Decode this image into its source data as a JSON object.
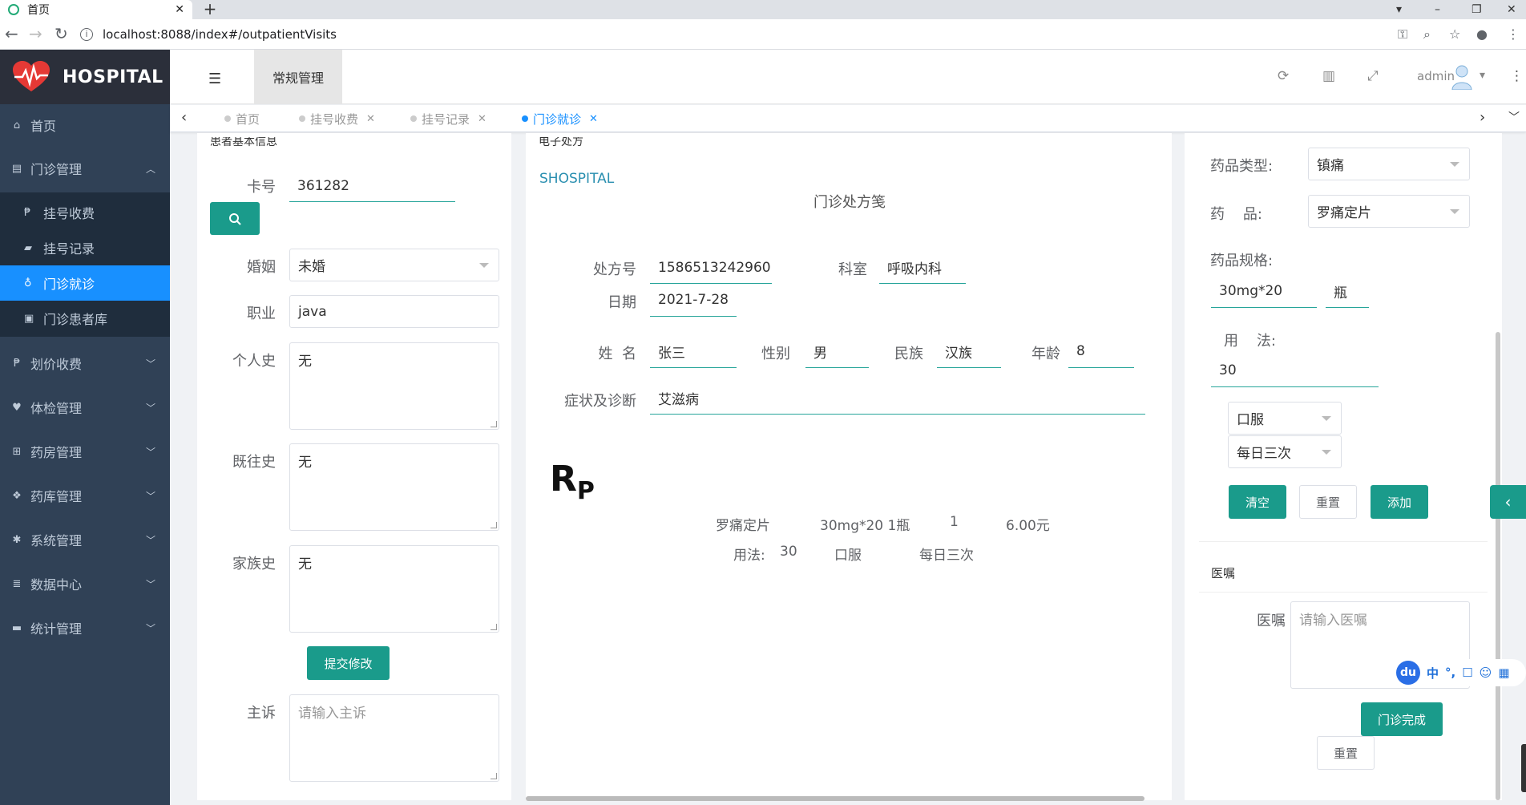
{
  "browser": {
    "tab_title": "首页",
    "new_tab": "+",
    "url": "localhost:8088/index#/outpatientVisits"
  },
  "app": {
    "name": "HOSPITAL"
  },
  "sidebar": {
    "home": "首页",
    "outpatient": "门诊管理",
    "sub": [
      "挂号收费",
      "挂号记录",
      "门诊就诊",
      "门诊患者库"
    ],
    "pricing": "划价收费",
    "exam": "体检管理",
    "pharmacy": "药房管理",
    "warehouse": "药库管理",
    "system": "系统管理",
    "data": "数据中心",
    "stats": "统计管理"
  },
  "header": {
    "section": "常规管理",
    "user": "admin"
  },
  "tags": [
    "首页",
    "挂号收费",
    "挂号记录",
    "门诊就诊"
  ],
  "patient": {
    "heading": "患者基本信息",
    "card_label": "卡号",
    "card_value": "361282",
    "marriage_label": "婚姻",
    "marriage_value": "未婚",
    "job_label": "职业",
    "job_value": "java",
    "personal_label": "个人史",
    "personal_value": "无",
    "past_label": "既往史",
    "past_value": "无",
    "family_label": "家族史",
    "family_value": "无",
    "submit": "提交修改",
    "complaint_label": "主诉",
    "complaint_placeholder": "请输入主诉"
  },
  "prescription": {
    "heading": "电子处方",
    "brand": "SHOSPITAL",
    "title": "门诊处方笺",
    "no_label": "处方号",
    "no_value": "1586513242960",
    "dept_label": "科室",
    "dept_value": "呼吸内科",
    "date_label": "日期",
    "date_value": "2021-7-28",
    "name_label": "姓  名",
    "name_value": "张三",
    "gender_label": "性别",
    "gender_value": "男",
    "ethnic_label": "民族",
    "ethnic_value": "汉族",
    "age_label": "年龄",
    "age_value": "8",
    "diag_label": "症状及诊断",
    "diag_value": "艾滋病",
    "rp_r": "R",
    "rp_p": "P",
    "drug_name": "罗痛定片",
    "drug_spec": "30mg*20 1瓶",
    "drug_qty": "1",
    "drug_price": "6.00元",
    "usage_label": "用法:",
    "usage_value": "30",
    "usage_route": "口服",
    "usage_freq": "每日三次"
  },
  "drugform": {
    "type_label": "药品类型:",
    "type_value": "镇痛",
    "drug_label": "药    品:",
    "drug_value": "罗痛定片",
    "spec_label": "药品规格:",
    "spec_value": "30mg*20",
    "unit_value": "瓶",
    "usage_label": "用    法:",
    "usage_value": "30",
    "route_value": "口服",
    "freq_value": "每日三次",
    "clear": "清空",
    "reset": "重置",
    "add": "添加",
    "advice_heading": "医嘱",
    "advice_label": "医嘱",
    "advice_placeholder": "请输入医嘱",
    "done": "门诊完成",
    "reset2": "重置"
  },
  "ime": [
    "中",
    "°,"
  ],
  "colors": {
    "accent": "#1a9b8b",
    "sidebar": "#304156",
    "active": "#1890ff"
  }
}
